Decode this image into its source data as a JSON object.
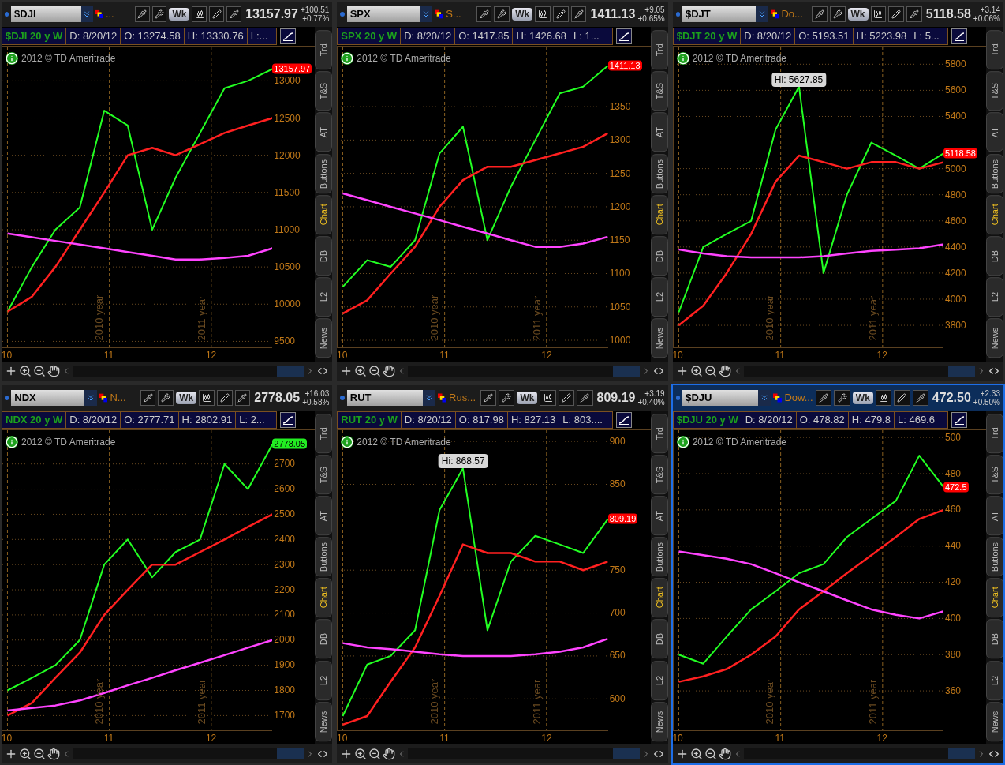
{
  "panels": [
    {
      "selected": false,
      "symbol": "$DJI",
      "description": "...",
      "price": "13157.97",
      "change": "+100.51",
      "change_pct": "+0.77%",
      "period": "Wk",
      "info": {
        "title": "$DJI 20 y W",
        "cells": [
          "D: 8/20/12",
          "O: 13274.58",
          "H: 13330.76",
          "L:..."
        ]
      },
      "copyright": "2012 © TD Ameritrade",
      "price_tag": {
        "text": "13157.97",
        "color": "#ff0000"
      },
      "side_tabs": [
        {
          "label": "Trd",
          "selected": false
        },
        {
          "label": "T&S",
          "selected": false
        },
        {
          "label": "AT",
          "selected": false
        },
        {
          "label": "Buttons",
          "selected": false
        },
        {
          "label": "Chart",
          "selected": true
        },
        {
          "label": "DB",
          "selected": false
        },
        {
          "label": "L2",
          "selected": false
        },
        {
          "label": "News",
          "selected": false
        }
      ],
      "chart_data": {
        "type": "line",
        "x": [
          10,
          10.24,
          10.47,
          10.71,
          10.95,
          11.18,
          11.42,
          11.65,
          11.89,
          12.13,
          12.36,
          12.6
        ],
        "grid": true,
        "ylim": [
          9425,
          13460
        ],
        "xlim": [
          9.95,
          12.6
        ],
        "yticks": [
          9500,
          10000,
          10500,
          11000,
          11500,
          12000,
          12500,
          13000
        ],
        "xticks": [
          10,
          11,
          12
        ],
        "series": [
          {
            "color": "#22ff22",
            "values": [
              9900,
              10500,
              11000,
              11300,
              12600,
              12400,
              11000,
              11700,
              12300,
              12900,
              13000,
              13157.97
            ]
          },
          {
            "color": "#ff2020",
            "values": [
              9900,
              10100,
              10500,
              11000,
              11500,
              12000,
              12100,
              12000,
              12150,
              12300,
              12400,
              12500
            ]
          },
          {
            "color": "#ff44ff",
            "values": [
              10950,
              10900,
              10850,
              10800,
              10750,
              10700,
              10650,
              10600,
              10600,
              10620,
              10650,
              10750
            ]
          }
        ],
        "annotations": [
          "2010 year",
          "2011 year"
        ]
      }
    },
    {
      "selected": false,
      "symbol": "SPX",
      "description": "S...",
      "price": "1411.13",
      "change": "+9.05",
      "change_pct": "+0.65%",
      "period": "Wk",
      "info": {
        "title": "SPX 20 y W",
        "cells": [
          "D: 8/20/12",
          "O: 1417.85",
          "H: 1426.68",
          "L: 1..."
        ]
      },
      "copyright": "2012 © TD Ameritrade",
      "price_tag": {
        "text": "1411.13",
        "color": "#ff0000"
      },
      "side_tabs": [
        {
          "label": "Trd",
          "selected": false
        },
        {
          "label": "T&S",
          "selected": false
        },
        {
          "label": "AT",
          "selected": false
        },
        {
          "label": "Buttons",
          "selected": false
        },
        {
          "label": "Chart",
          "selected": true
        },
        {
          "label": "DB",
          "selected": false
        },
        {
          "label": "L2",
          "selected": false
        },
        {
          "label": "News",
          "selected": false
        }
      ],
      "chart_data": {
        "type": "line",
        "x": [
          10,
          10.24,
          10.47,
          10.71,
          10.95,
          11.18,
          11.42,
          11.65,
          11.89,
          12.13,
          12.36,
          12.6
        ],
        "grid": true,
        "ylim": [
          990,
          1440
        ],
        "xlim": [
          9.95,
          12.6
        ],
        "yticks": [
          1000,
          1050,
          1100,
          1150,
          1200,
          1250,
          1300,
          1350
        ],
        "xticks": [
          10,
          11,
          12
        ],
        "series": [
          {
            "color": "#22ff22",
            "values": [
              1080,
              1120,
              1110,
              1150,
              1280,
              1320,
              1150,
              1230,
              1300,
              1370,
              1380,
              1411.13
            ]
          },
          {
            "color": "#ff2020",
            "values": [
              1040,
              1060,
              1100,
              1140,
              1200,
              1240,
              1260,
              1260,
              1270,
              1280,
              1290,
              1310
            ]
          },
          {
            "color": "#ff44ff",
            "values": [
              1220,
              1210,
              1200,
              1190,
              1180,
              1170,
              1160,
              1150,
              1140,
              1140,
              1145,
              1155
            ]
          }
        ],
        "annotations": [
          "2010 year",
          "2011 year"
        ]
      }
    },
    {
      "selected": false,
      "symbol": "$DJT",
      "description": "Do...",
      "price": "5118.58",
      "change": "+3.14",
      "change_pct": "+0.06%",
      "period": "Wk",
      "info": {
        "title": "$DJT 20 y W",
        "cells": [
          "D: 8/20/12",
          "O: 5193.51",
          "H: 5223.98",
          "L: 5..."
        ]
      },
      "copyright": "2012 © TD Ameritrade",
      "price_tag": {
        "text": "5118.58",
        "color": "#ff0000"
      },
      "side_tabs": [
        {
          "label": "Trd",
          "selected": false
        },
        {
          "label": "T&S",
          "selected": false
        },
        {
          "label": "AT",
          "selected": false
        },
        {
          "label": "Buttons",
          "selected": false
        },
        {
          "label": "Chart",
          "selected": true
        },
        {
          "label": "DB",
          "selected": false
        },
        {
          "label": "L2",
          "selected": false
        },
        {
          "label": "News",
          "selected": false
        }
      ],
      "chart_data": {
        "type": "line",
        "x": [
          10,
          10.24,
          10.47,
          10.71,
          10.95,
          11.18,
          11.42,
          11.65,
          11.89,
          12.13,
          12.36,
          12.6
        ],
        "grid": true,
        "ylim": [
          3634,
          5935
        ],
        "xlim": [
          9.95,
          12.6
        ],
        "yticks": [
          3800,
          4000,
          4200,
          4400,
          4600,
          4800,
          5000,
          5400,
          5600,
          5800
        ],
        "xticks": [
          10,
          11,
          12
        ],
        "series": [
          {
            "color": "#22ff22",
            "values": [
              3900,
              4400,
              4500,
              4600,
              5300,
              5627.85,
              4200,
              4800,
              5200,
              5100,
              5000,
              5118.58
            ]
          },
          {
            "color": "#ff2020",
            "values": [
              3800,
              3950,
              4200,
              4500,
              4900,
              5100,
              5050,
              5000,
              5050,
              5050,
              5000,
              5050
            ]
          },
          {
            "color": "#ff44ff",
            "values": [
              4380,
              4350,
              4330,
              4320,
              4320,
              4320,
              4330,
              4350,
              4370,
              4380,
              4390,
              4420
            ]
          }
        ],
        "annotations": [
          "2010 year",
          "2011 year",
          {
            "x": 11.18,
            "y": 5627.85,
            "text": "Hi: 5627.85"
          }
        ]
      }
    },
    {
      "selected": false,
      "symbol": "NDX",
      "description": "N...",
      "price": "2778.05",
      "change": "+16.03",
      "change_pct": "+0.58%",
      "period": "Wk",
      "info": {
        "title": "NDX 20 y W",
        "cells": [
          "D: 8/20/12",
          "O: 2777.71",
          "H: 2802.91",
          "L: 2..."
        ]
      },
      "copyright": "2012 © TD Ameritrade",
      "price_tag": {
        "text": "2778.05",
        "color": "#22ee22"
      },
      "side_tabs": [
        {
          "label": "Trd",
          "selected": false
        },
        {
          "label": "T&S",
          "selected": false
        },
        {
          "label": "AT",
          "selected": false
        },
        {
          "label": "Buttons",
          "selected": false
        },
        {
          "label": "Chart",
          "selected": true
        },
        {
          "label": "DB",
          "selected": false
        },
        {
          "label": "L2",
          "selected": false
        },
        {
          "label": "News",
          "selected": false
        }
      ],
      "chart_data": {
        "type": "line",
        "x": [
          10,
          10.24,
          10.47,
          10.71,
          10.95,
          11.18,
          11.42,
          11.65,
          11.89,
          12.13,
          12.36,
          12.6
        ],
        "grid": true,
        "ylim": [
          1640,
          2834
        ],
        "xlim": [
          9.95,
          12.6
        ],
        "yticks": [
          1700,
          1800,
          1900,
          2000,
          2100,
          2200,
          2300,
          2400,
          2500,
          2600,
          2700
        ],
        "xticks": [
          10,
          11,
          12
        ],
        "series": [
          {
            "color": "#22ff22",
            "values": [
              1800,
              1850,
              1900,
              2000,
              2300,
              2400,
              2250,
              2350,
              2400,
              2700,
              2600,
              2778.05
            ]
          },
          {
            "color": "#ff2020",
            "values": [
              1700,
              1750,
              1850,
              1950,
              2100,
              2200,
              2300,
              2300,
              2350,
              2400,
              2450,
              2500
            ]
          },
          {
            "color": "#ff44ff",
            "values": [
              1720,
              1730,
              1740,
              1760,
              1790,
              1820,
              1850,
              1880,
              1910,
              1940,
              1970,
              2000
            ]
          }
        ],
        "annotations": [
          "2010 year",
          "2011 year"
        ]
      }
    },
    {
      "selected": false,
      "symbol": "RUT",
      "description": "Rus...",
      "price": "809.19",
      "change": "+3.19",
      "change_pct": "+0.40%",
      "period": "Wk",
      "info": {
        "title": "RUT 20 y W",
        "cells": [
          "D: 8/20/12",
          "O: 817.98",
          "H: 827.13",
          "L: 803...."
        ]
      },
      "copyright": "2012 © TD Ameritrade",
      "price_tag": {
        "text": "809.19",
        "color": "#ff0000"
      },
      "side_tabs": [
        {
          "label": "Trd",
          "selected": false
        },
        {
          "label": "T&S",
          "selected": false
        },
        {
          "label": "AT",
          "selected": false
        },
        {
          "label": "Buttons",
          "selected": false
        },
        {
          "label": "Chart",
          "selected": true
        },
        {
          "label": "DB",
          "selected": false
        },
        {
          "label": "L2",
          "selected": false
        },
        {
          "label": "News",
          "selected": false
        }
      ],
      "chart_data": {
        "type": "line",
        "x": [
          10,
          10.24,
          10.47,
          10.71,
          10.95,
          11.18,
          11.42,
          11.65,
          11.89,
          12.13,
          12.36,
          12.6
        ],
        "grid": true,
        "ylim": [
          563,
          913
        ],
        "xlim": [
          9.95,
          12.6
        ],
        "yticks": [
          600,
          650,
          700,
          750,
          850,
          900
        ],
        "xticks": [
          10,
          11,
          12
        ],
        "series": [
          {
            "color": "#22ff22",
            "values": [
              580,
              640,
              650,
              680,
              820,
              868.57,
              680,
              760,
              790,
              780,
              770,
              809.19
            ]
          },
          {
            "color": "#ff2020",
            "values": [
              570,
              580,
              620,
              660,
              720,
              780,
              770,
              770,
              760,
              760,
              750,
              760
            ]
          },
          {
            "color": "#ff44ff",
            "values": [
              665,
              660,
              658,
              655,
              652,
              650,
              650,
              650,
              652,
              655,
              660,
              670
            ]
          }
        ],
        "annotations": [
          "2010 year",
          "2011 year",
          {
            "x": 11.18,
            "y": 868.57,
            "text": "Hi: 868.57"
          }
        ]
      }
    },
    {
      "selected": true,
      "symbol": "$DJU",
      "description": "Dow...",
      "price": "472.50",
      "change": "+2.33",
      "change_pct": "+0.50%",
      "period": "Wk",
      "info": {
        "title": "$DJU 20 y W",
        "cells": [
          "D: 8/20/12",
          "O: 478.82",
          "H: 479.8",
          "L: 469.6"
        ]
      },
      "copyright": "2012 © TD Ameritrade",
      "price_tag": {
        "text": "472.5",
        "color": "#ff0000"
      },
      "side_tabs": [
        {
          "label": "Trd",
          "selected": false
        },
        {
          "label": "T&S",
          "selected": false
        },
        {
          "label": "AT",
          "selected": false
        },
        {
          "label": "Buttons",
          "selected": false
        },
        {
          "label": "Chart",
          "selected": true
        },
        {
          "label": "DB",
          "selected": false
        },
        {
          "label": "L2",
          "selected": false
        },
        {
          "label": "News",
          "selected": false
        }
      ],
      "chart_data": {
        "type": "line",
        "x": [
          10,
          10.24,
          10.47,
          10.71,
          10.95,
          11.18,
          11.42,
          11.65,
          11.89,
          12.13,
          12.36,
          12.6
        ],
        "grid": true,
        "ylim": [
          338,
          504
        ],
        "xlim": [
          9.95,
          12.6
        ],
        "yticks": [
          360,
          380,
          400,
          420,
          440,
          460,
          480,
          500
        ],
        "xticks": [
          10,
          11,
          12
        ],
        "series": [
          {
            "color": "#22ff22",
            "values": [
              380,
              375,
              390,
              405,
              415,
              425,
              430,
              445,
              455,
              465,
              490,
              472.5
            ]
          },
          {
            "color": "#ff2020",
            "values": [
              365,
              368,
              372,
              380,
              390,
              405,
              415,
              425,
              435,
              445,
              455,
              460
            ]
          },
          {
            "color": "#ff44ff",
            "values": [
              437,
              435,
              433,
              430,
              425,
              420,
              415,
              410,
              405,
              402,
              400,
              404
            ]
          }
        ],
        "annotations": [
          "2010 year",
          "2011 year"
        ]
      }
    }
  ]
}
